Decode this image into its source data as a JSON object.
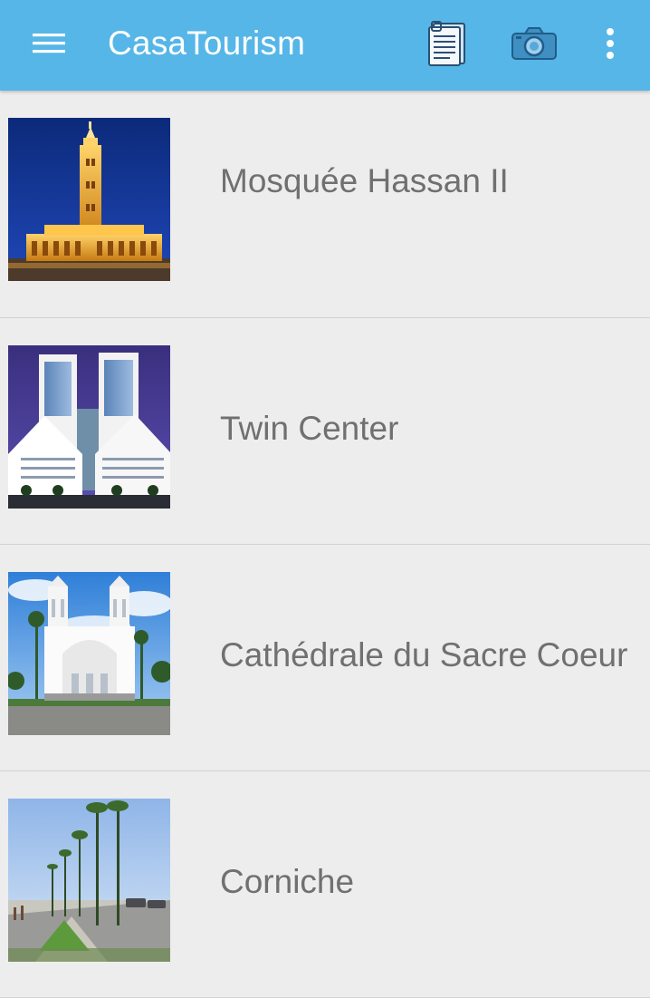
{
  "app_bar": {
    "title": "CasaTourism",
    "background_color": "#56b6e7",
    "icons": {
      "menu": "hamburger-menu-icon",
      "documents": "document-list-icon",
      "camera": "camera-icon",
      "overflow": "more-vertical-icon"
    }
  },
  "places": [
    {
      "name": "Mosquée Hassan II",
      "image": "hassan-ii-mosque-photo"
    },
    {
      "name": "Twin Center",
      "image": "twin-center-photo"
    },
    {
      "name": "Cathédrale du Sacre Coeur",
      "image": "sacre-coeur-cathedral-photo"
    },
    {
      "name": "Corniche",
      "image": "corniche-promenade-photo"
    }
  ],
  "colors": {
    "list_background": "#ededed",
    "label_text": "#707070",
    "divider": "#d2d2d2"
  }
}
